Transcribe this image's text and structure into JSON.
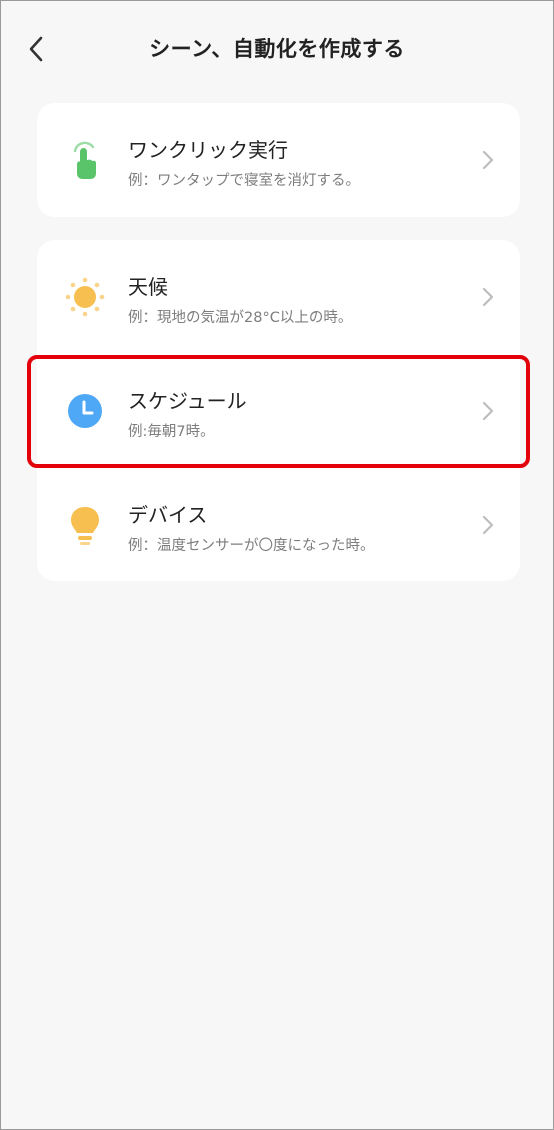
{
  "header": {
    "title": "シーン、自動化を作成する",
    "back_icon": "chevron-left-icon"
  },
  "groups": [
    {
      "items": [
        {
          "id": "one-click",
          "title": "ワンクリック実行",
          "subtitle": "例：ワンタップで寝室を消灯する。",
          "icon": "tap-hand-icon",
          "icon_color": "#5ac46a"
        }
      ]
    },
    {
      "items": [
        {
          "id": "weather",
          "title": "天候",
          "subtitle": "例：現地の気温が28°C以上の時。",
          "icon": "sun-icon",
          "icon_color": "#f6bf4f"
        },
        {
          "id": "schedule",
          "title": "スケジュール",
          "subtitle": "例:毎朝7時。",
          "icon": "clock-icon",
          "icon_color": "#4ea8f5"
        },
        {
          "id": "device",
          "title": "デバイス",
          "subtitle": "例：温度センサーが〇度になった時。",
          "icon": "lightbulb-icon",
          "icon_color": "#f6bf4f"
        }
      ]
    }
  ],
  "highlight": {
    "target": "schedule",
    "color": "#e3000b"
  },
  "colors": {
    "background": "#f7f7f7",
    "card": "#ffffff",
    "subtitle": "#7d7d7d",
    "chevron": "#bdbdbd"
  }
}
